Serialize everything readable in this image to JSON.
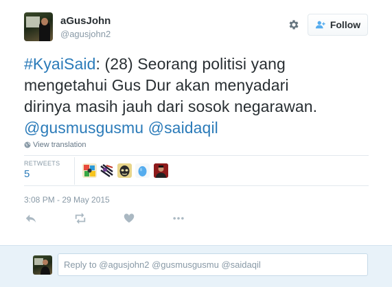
{
  "author": {
    "name": "aGusJohn",
    "handle": "@agusjohn2"
  },
  "follow_button": {
    "label": "Follow"
  },
  "tweet": {
    "hashtag": "#KyaiSaid",
    "text_line1": ": (28) Seorang politisi yang",
    "text_line2": "mengetahui Gus Dur akan menyadari",
    "text_line3": "dirinya masih jauh dari sosok negarawan.",
    "mention1": "@gusmusgusmu",
    "mention2": "@saidaqil"
  },
  "view_translation": "View translation",
  "stats": {
    "retweets_label": "RETWEETS",
    "retweets_value": "5"
  },
  "retweeters_avatar_icons": [
    "avatar-colorful-icon",
    "avatar-dark-lines-icon",
    "avatar-mask-icon",
    "avatar-egg-icon",
    "avatar-person-icon"
  ],
  "timestamp": "3:08 PM - 29 May 2015",
  "actions": [
    "reply-icon",
    "retweet-icon",
    "like-icon",
    "more-icon"
  ],
  "reply": {
    "placeholder": "Reply to @agusjohn2 @gusmusgusmu @saidaqil"
  },
  "colors": {
    "link": "#2b7bb9",
    "muted": "#8899a6",
    "reply_bg": "#e8f2f9",
    "action_icon": "#aab8c2"
  }
}
